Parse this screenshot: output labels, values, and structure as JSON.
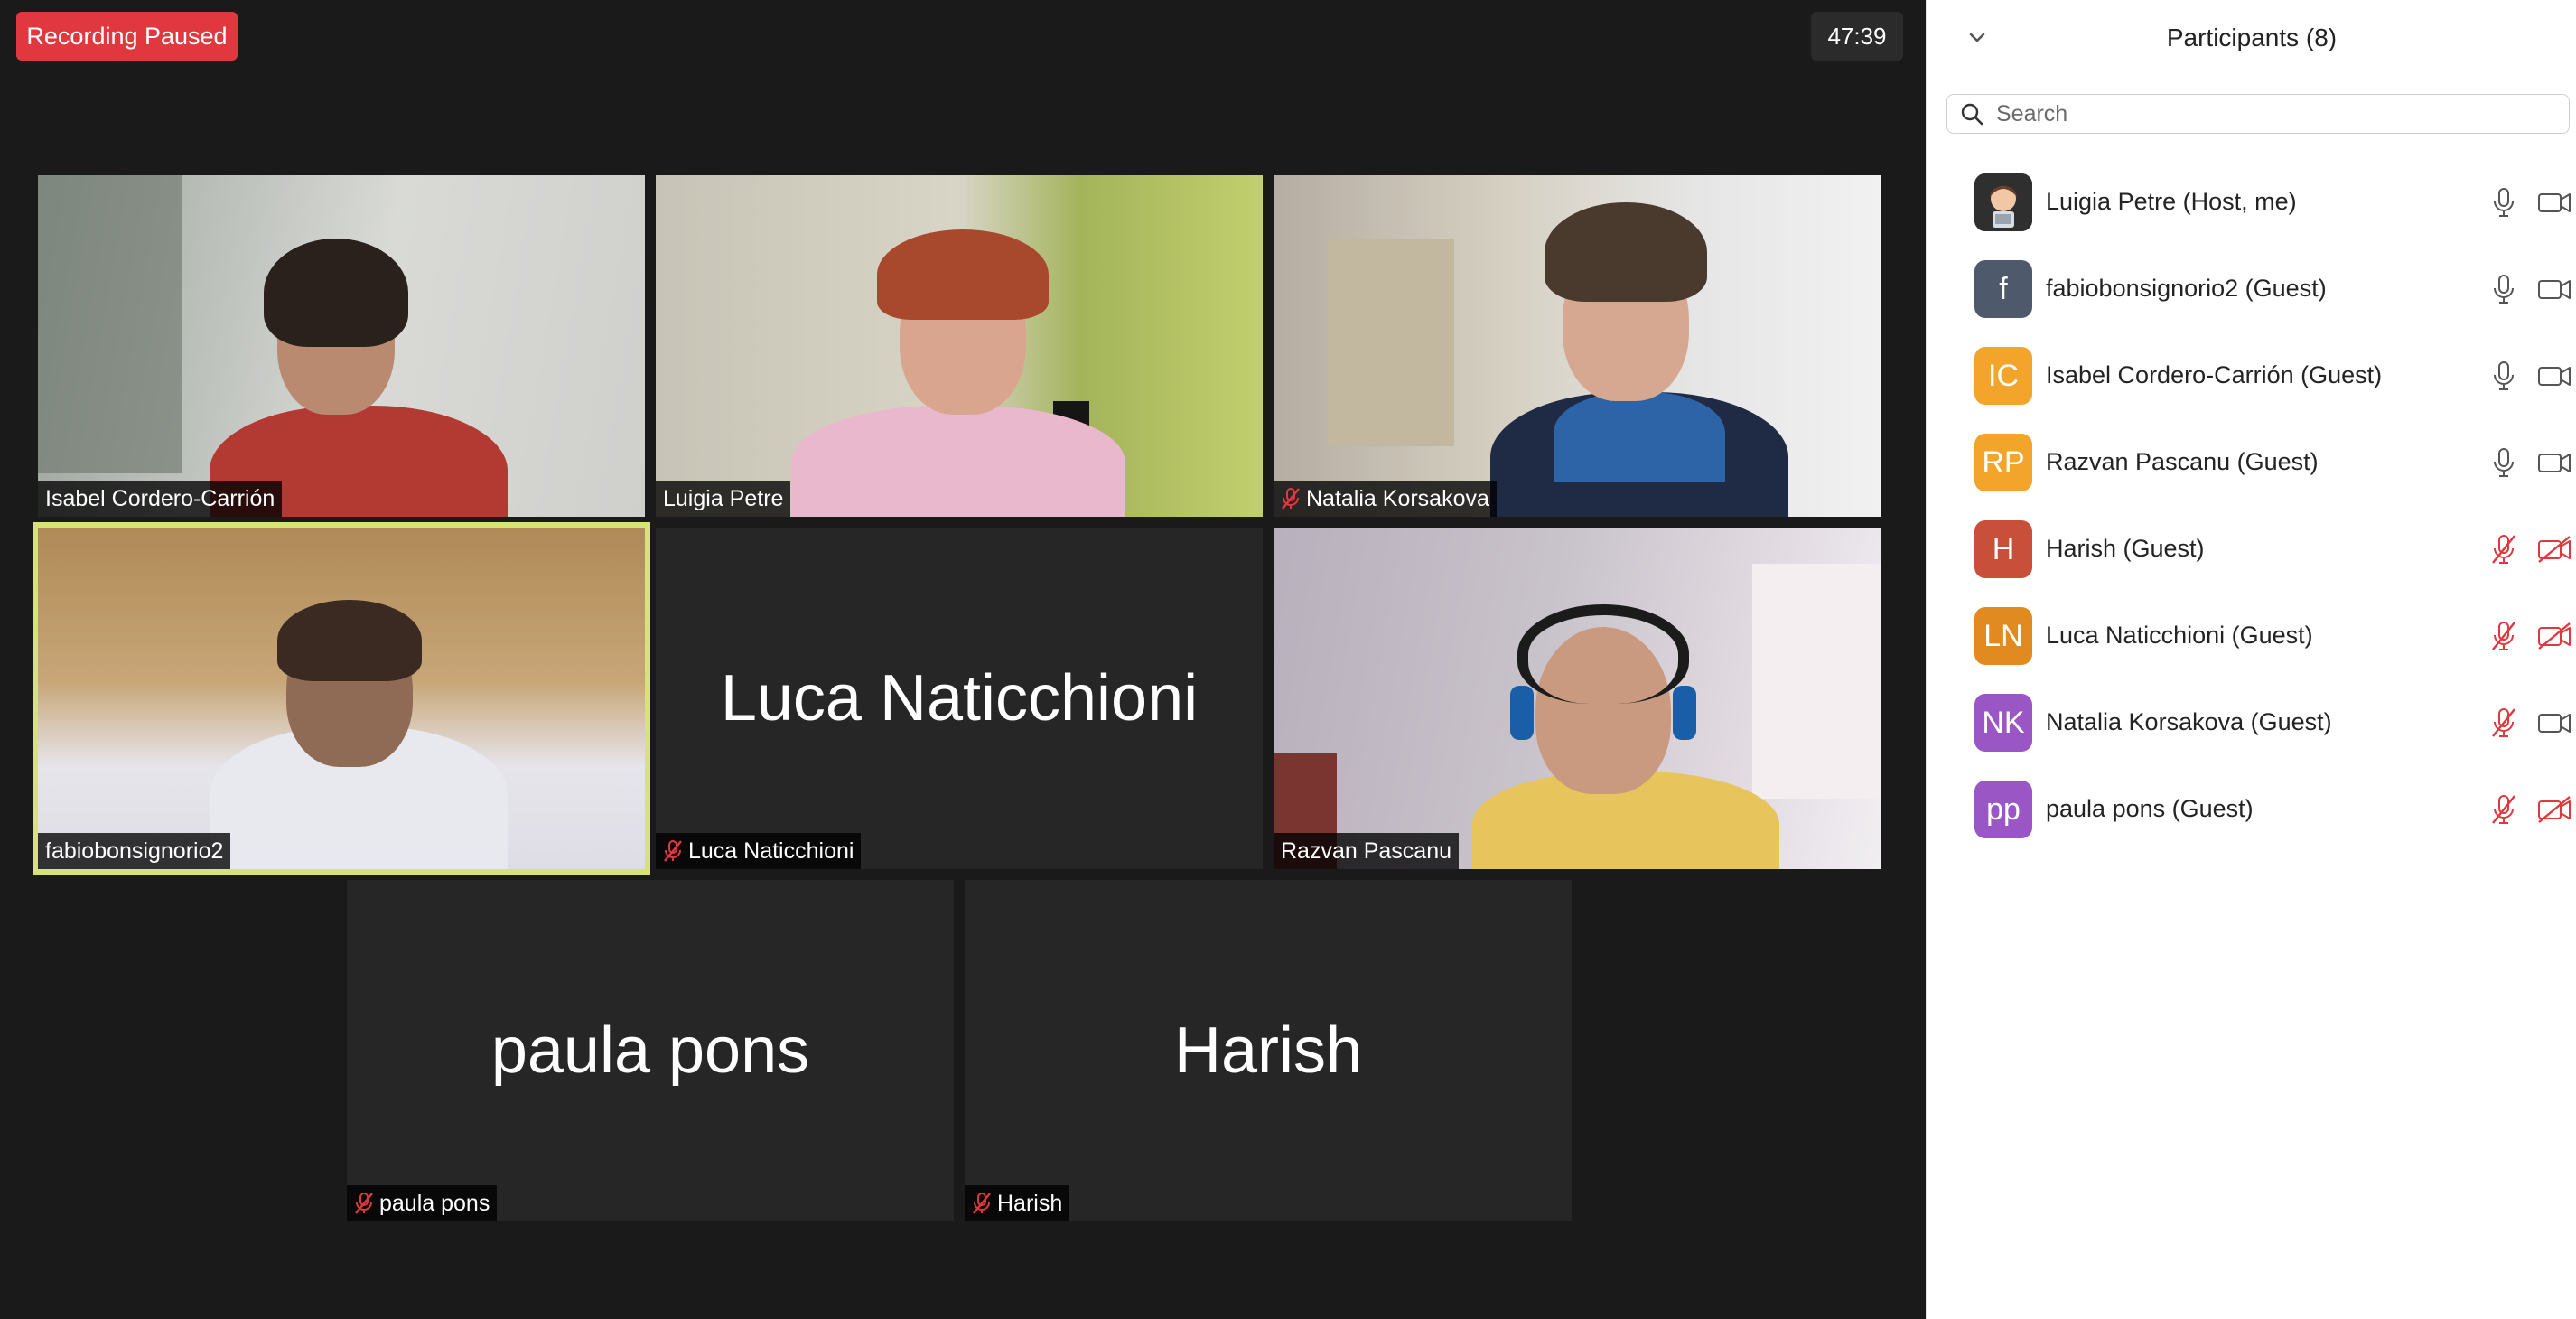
{
  "recording_badge": "Recording Paused",
  "timer": "47:39",
  "tiles": [
    {
      "name": "Isabel Cordero-Carrión",
      "video": true,
      "muted": false
    },
    {
      "name": "Luigia Petre",
      "video": true,
      "muted": false
    },
    {
      "name": "Natalia Korsakova",
      "video": true,
      "muted": true
    },
    {
      "name": "fabiobonsignorio2",
      "video": true,
      "muted": false,
      "active_speaker": true
    },
    {
      "name": "Luca Naticchioni",
      "big_name": "Luca Naticchioni",
      "video": false,
      "muted": true
    },
    {
      "name": "Razvan Pascanu",
      "video": true,
      "muted": false
    },
    {
      "name": "paula pons",
      "big_name": "paula pons",
      "video": false,
      "muted": true
    },
    {
      "name": "Harish",
      "big_name": "Harish",
      "video": false,
      "muted": true
    }
  ],
  "panel": {
    "title": "Participants (8)",
    "search_placeholder": "Search",
    "participants": [
      {
        "name": "Luigia Petre (Host, me)",
        "initials": "",
        "avatar_color": "#3b3b3b",
        "mic": "on",
        "cam": "on"
      },
      {
        "name": "fabiobonsignorio2 (Guest)",
        "initials": "f",
        "avatar_color": "#4e5a6b",
        "mic": "on",
        "cam": "on"
      },
      {
        "name": "Isabel Cordero-Carrión (Guest)",
        "initials": "IC",
        "avatar_color": "#f2a52a",
        "mic": "on",
        "cam": "on"
      },
      {
        "name": "Razvan Pascanu (Guest)",
        "initials": "RP",
        "avatar_color": "#f2a52a",
        "mic": "on",
        "cam": "on"
      },
      {
        "name": "Harish (Guest)",
        "initials": "H",
        "avatar_color": "#c8503a",
        "mic": "off",
        "cam": "off"
      },
      {
        "name": "Luca Naticchioni (Guest)",
        "initials": "LN",
        "avatar_color": "#e08a1f",
        "mic": "off",
        "cam": "off"
      },
      {
        "name": "Natalia Korsakova (Guest)",
        "initials": "NK",
        "avatar_color": "#9a56c4",
        "mic": "off",
        "cam": "on"
      },
      {
        "name": "paula pons (Guest)",
        "initials": "pp",
        "avatar_color": "#9a56c4",
        "mic": "off",
        "cam": "off"
      }
    ]
  }
}
